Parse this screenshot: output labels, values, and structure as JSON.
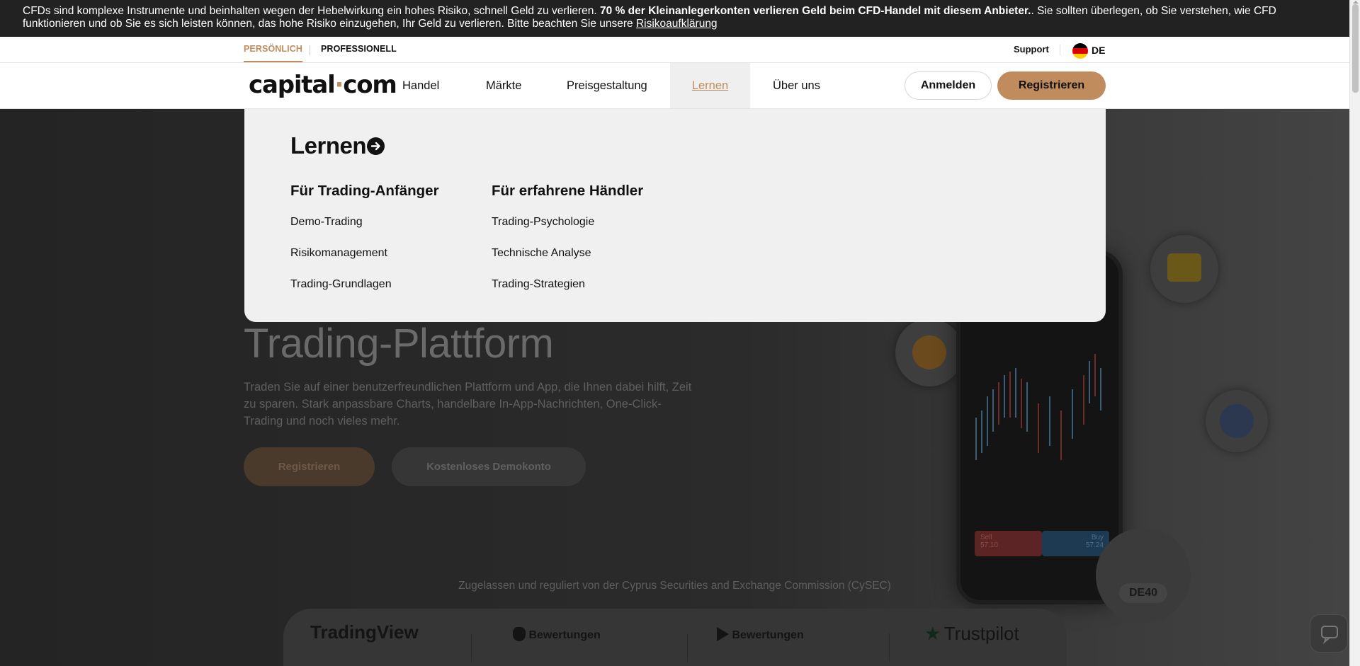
{
  "risk_banner": {
    "text_1": "CFDs sind komplexe Instrumente und beinhalten wegen der Hebelwirkung ein hohes Risiko, schnell Geld zu verlieren. ",
    "bold": "70 % der Kleinanlegerkonten verlieren Geld beim CFD-Handel mit diesem Anbieter.",
    "text_2": ". Sie sollten überlegen, ob Sie verstehen, wie CFD funktionieren und ob Sie es sich leisten können, das hohe Risiko einzugehen, Ihr Geld zu verlieren. Bitte beachten Sie unsere ",
    "link": "Risikoaufklärung"
  },
  "topbar": {
    "segment_personal": "PERSÖNLICH",
    "segment_professional": "PROFESSIONELL",
    "support": "Support",
    "language": "DE",
    "flag_colors": [
      "#000000",
      "#dd0000",
      "#ffce00"
    ]
  },
  "nav": {
    "logo_left": "capital",
    "logo_dot": "·",
    "logo_right": "com",
    "items": [
      "Handel",
      "Märkte",
      "Preisgestaltung",
      "Lernen",
      "Über uns"
    ],
    "active_item": "Lernen",
    "login": "Anmelden",
    "register": "Registrieren"
  },
  "menu": {
    "title": "Lernen",
    "columns": [
      {
        "heading": "Für Trading-Anfänger",
        "links": [
          "Demo-Trading",
          "Risikomanagement",
          "Trading-Grundlagen"
        ]
      },
      {
        "heading": "Für erfahrene Händler",
        "links": [
          "Trading-Psychologie",
          "Technische Analyse",
          "Trading-Strategien"
        ]
      }
    ]
  },
  "hero": {
    "title": "Trading-Plattform",
    "text": "Traden Sie auf einer benutzerfreundlichen Plattform und App, die Ihnen dabei hilft, Zeit zu sparen. Stark anpassbare Charts, handelbare In-App-Nachrichten, One-Click-Trading und noch vieles mehr.",
    "cta_register": "Registrieren",
    "cta_demo": "Kostenloses Demokonto",
    "regulated": "Zugelassen und reguliert von der Cyprus Securities and Exchange Commission (CySEC)",
    "phone_sell": "Sell",
    "phone_sell_price": "57.10",
    "phone_buy": "Buy",
    "phone_buy_price": "57.24",
    "de40": "DE40"
  },
  "ratings": {
    "tradingview": "TradingView",
    "apple_label": "Bewertungen",
    "google_label": "Bewertungen",
    "trustpilot": "Trustpilot"
  },
  "colors": {
    "accent": "#c08c5d",
    "banner_bg": "#222222",
    "menu_bg": "#f0f0f1"
  }
}
